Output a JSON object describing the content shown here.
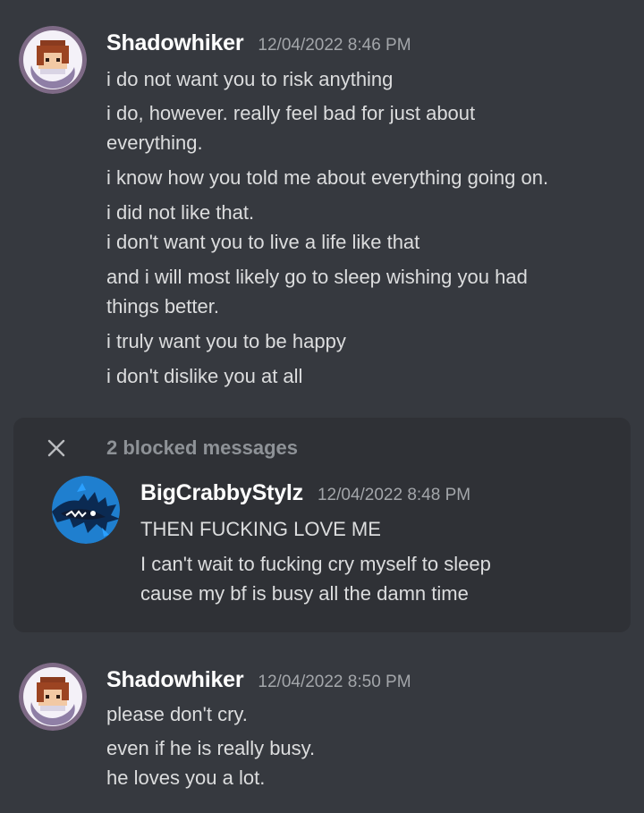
{
  "messages_top": {
    "author": "Shadowhiker",
    "timestamp": "12/04/2022 8:46 PM",
    "avatar_icon": "pixel-character-avatar",
    "lines": [
      "i do not want you to risk anything",
      "i do, however. really feel bad for just about",
      "everything.",
      "i know how you told me about everything going on.",
      "i did not like that.",
      "i don't want you to live a life like that",
      "and i will most likely go to sleep wishing you had",
      "things better.",
      "i truly want you to be happy",
      "i don't dislike you at all"
    ]
  },
  "blocked": {
    "label": "2 blocked messages",
    "close_icon": "close-icon",
    "message": {
      "author": "BigCrabbyStylz",
      "timestamp": "12/04/2022 8:48 PM",
      "avatar_icon": "blue-dragon-avatar",
      "lines": [
        "THEN FUCKING LOVE ME",
        "I can't wait to fucking cry myself to sleep",
        "cause my bf is busy all the damn time"
      ]
    }
  },
  "messages_bottom": {
    "author": "Shadowhiker",
    "timestamp": "12/04/2022 8:50 PM",
    "avatar_icon": "pixel-character-avatar",
    "lines": [
      "please don't cry.",
      "even if he is really busy.",
      "he loves you a lot."
    ]
  },
  "colors": {
    "background": "#36393f",
    "blocked_background": "#2f3136",
    "username": "#ffffff",
    "text": "#dcddde",
    "timestamp": "#a3a6aa"
  }
}
